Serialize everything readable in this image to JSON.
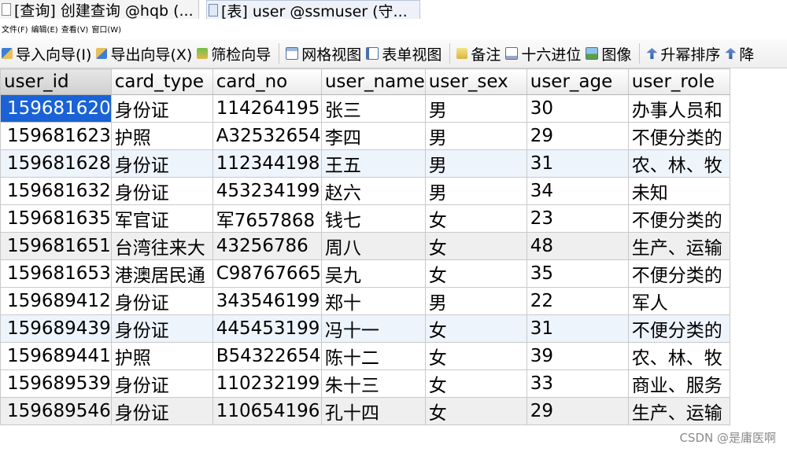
{
  "tabs": [
    {
      "label": "[查询] 创建查询 @hqb (..."
    },
    {
      "label": "[表] user @ssmuser (守..."
    }
  ],
  "menu": [
    "文件(F)",
    "编辑(E)",
    "查看(V)",
    "窗口(W)"
  ],
  "toolbar": {
    "import_label": "导入向导(I)",
    "export_label": "导出向导(X)",
    "filter_label": "筛检向导",
    "grid_view_label": "网格视图",
    "form_view_label": "表单视图",
    "memo_label": "备注",
    "hex_label": "十六进位",
    "image_label": "图像",
    "sort_asc_label": "升幂排序",
    "sort_desc_label": "降"
  },
  "grid": {
    "columns": [
      "user_id",
      "card_type",
      "card_no",
      "user_name",
      "user_sex",
      "user_age",
      "user_role"
    ],
    "rows": [
      [
        "159681620",
        "身份证",
        "114264195",
        "张三",
        "男",
        "30",
        "办事人员和"
      ],
      [
        "159681623",
        "护照",
        "A32532654",
        "李四",
        "男",
        "29",
        "不便分类的"
      ],
      [
        "159681628",
        "身份证",
        "112344198",
        "王五",
        "男",
        "31",
        "农、林、牧"
      ],
      [
        "159681632",
        "身份证",
        "453234199",
        "赵六",
        "男",
        "34",
        "未知"
      ],
      [
        "159681635",
        "军官证",
        "军7657868",
        "钱七",
        "女",
        "23",
        "不便分类的"
      ],
      [
        "159681651",
        "台湾往来大",
        "43256786",
        "周八",
        "女",
        "48",
        "生产、运输"
      ],
      [
        "159681653",
        "港澳居民通",
        "C98767665",
        "吴九",
        "女",
        "35",
        "不便分类的"
      ],
      [
        "159689412",
        "身份证",
        "343546199",
        "郑十",
        "男",
        "22",
        "军人"
      ],
      [
        "159689439",
        "身份证",
        "445453199",
        "冯十一",
        "女",
        "31",
        "不便分类的"
      ],
      [
        "159689441",
        "护照",
        "B54322654",
        "陈十二",
        "女",
        "39",
        "农、林、牧"
      ],
      [
        "159689539",
        "身份证",
        "110232199",
        "朱十三",
        "女",
        "33",
        "商业、服务"
      ],
      [
        "159689546",
        "身份证",
        "110654196",
        "孔十四",
        "女",
        "29",
        "生产、运输"
      ]
    ]
  },
  "watermark": "CSDN @是庸医啊"
}
